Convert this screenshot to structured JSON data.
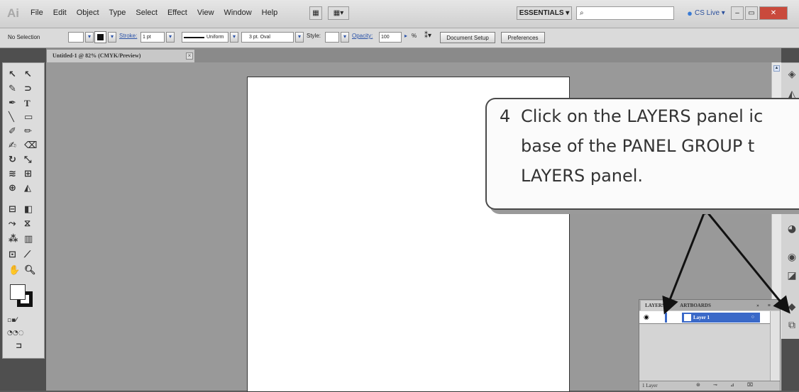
{
  "app": {
    "logo": "Ai"
  },
  "menubar": {
    "items": [
      "File",
      "Edit",
      "Object",
      "Type",
      "Select",
      "Effect",
      "View",
      "Window",
      "Help"
    ],
    "workspace": "ESSENTIALS ▾",
    "search_placeholder": "",
    "cslive": "CS Live ▾"
  },
  "options": {
    "selection": "No Selection",
    "stroke_label": "Stroke:",
    "stroke_weight": "1 pt",
    "uniform": "Uniform",
    "brush": "3 pt. Oval",
    "style_label": "Style:",
    "opacity_label": "Opacity:",
    "opacity_value": "100",
    "percent": "%",
    "document_setup": "Document Setup",
    "preferences": "Preferences"
  },
  "document": {
    "tab_title": "Untitled-1 @ 82% (CMYK/Preview)"
  },
  "callout": {
    "number": "4",
    "line1": "Click on the LAYERS panel ic",
    "line2": "base of the PANEL GROUP t",
    "line3": "LAYERS panel."
  },
  "layers_panel": {
    "tab_layers": "LAYERS",
    "tab_artboards": "ARTBOARDS",
    "layer_name": "Layer 1",
    "count": "1 Layer"
  },
  "colors": {
    "arrow": "#111111",
    "layer_selected": "#3a69c8"
  }
}
